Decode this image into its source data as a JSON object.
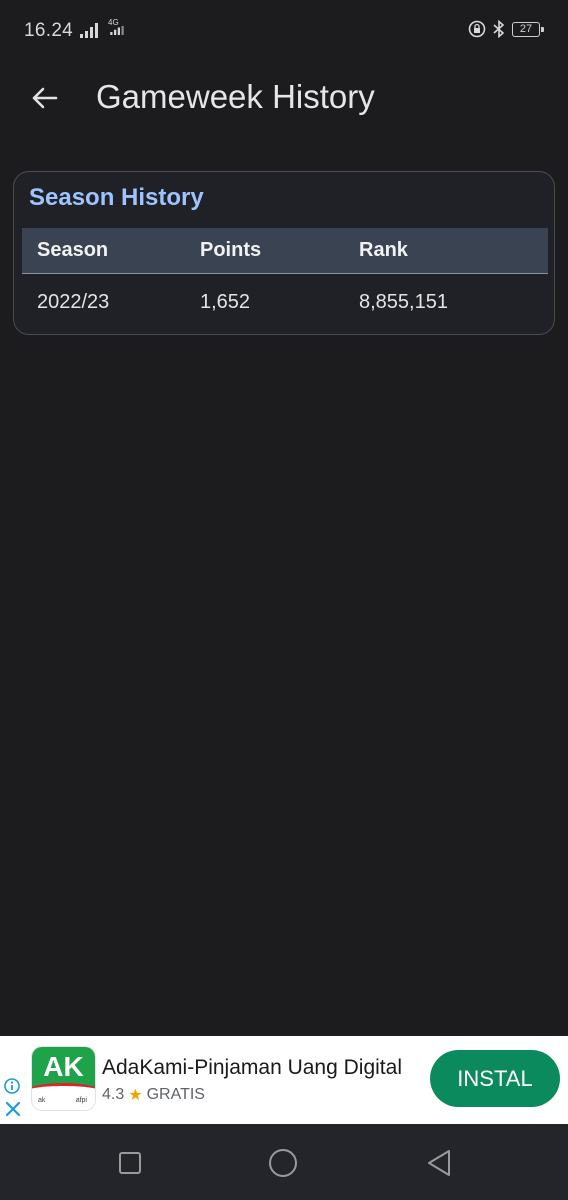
{
  "status_bar": {
    "time": "16.24",
    "network": "4G",
    "battery": "27"
  },
  "app_bar": {
    "title": "Gameweek History"
  },
  "season_card": {
    "title": "Season History",
    "columns": [
      "Season",
      "Points",
      "Rank"
    ],
    "rows": [
      {
        "season": "2022/23",
        "points": "1,652",
        "rank": "8,855,151"
      }
    ]
  },
  "ad": {
    "app_name": "AdaKami-Pinjaman Uang Digital",
    "rating": "4.3",
    "price": "GRATIS",
    "install_label": "INSTAL",
    "logo_text": "AK",
    "logo_foot_left": "ak",
    "logo_foot_right": "afpi"
  },
  "colors": {
    "background": "#1c1c1e",
    "card_title": "#9ec4ff",
    "table_header_bg": "#3a4352",
    "install_button": "#0b8a5e",
    "logo_green": "#1fa34a"
  }
}
